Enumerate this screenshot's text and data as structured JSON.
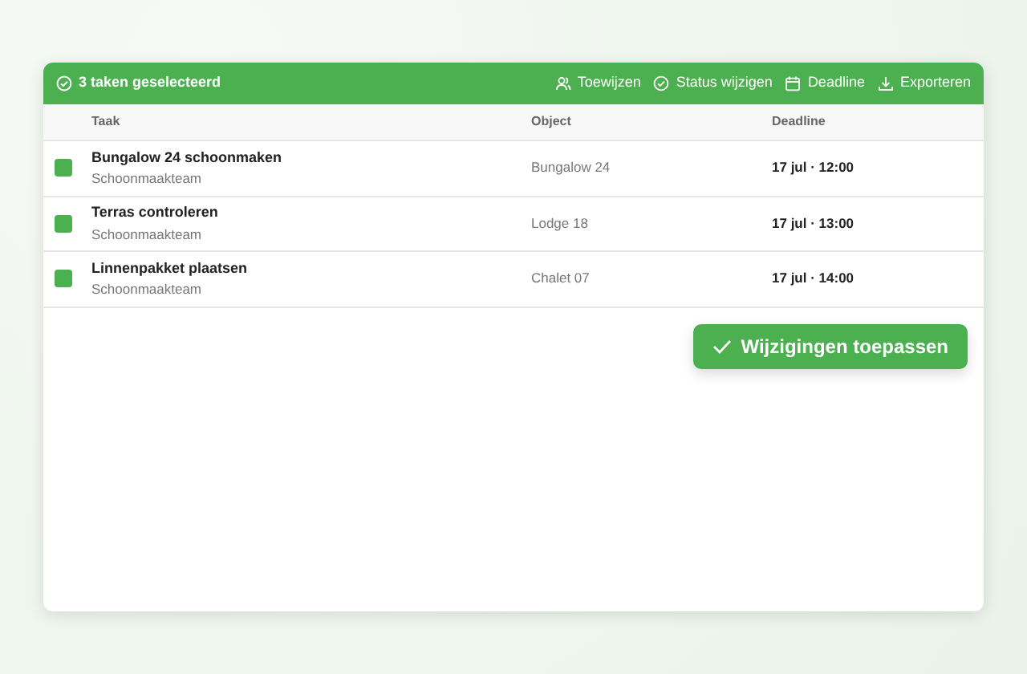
{
  "toolbar": {
    "selection_label": "3 taken geselecteerd",
    "actions": [
      {
        "kind": "assign",
        "label": "Toewijzen"
      },
      {
        "kind": "status",
        "label": "Status wijzigen"
      },
      {
        "kind": "deadline",
        "label": "Deadline"
      },
      {
        "kind": "export",
        "label": "Exporteren"
      }
    ]
  },
  "table": {
    "columns": [
      "Taak",
      "Object",
      "Deadline"
    ],
    "rows": [
      {
        "checked": true,
        "task": "Bungalow 24 schoonmaken",
        "team": "Schoonmaakteam",
        "object": "Bungalow 24",
        "deadline": "17 jul · 12:00"
      },
      {
        "checked": true,
        "task": "Terras controleren",
        "team": "Schoonmaakteam",
        "object": "Lodge 18",
        "deadline": "17 jul · 13:00"
      },
      {
        "checked": true,
        "task": "Linnenpakket plaatsen",
        "team": "Schoonmaakteam",
        "object": "Chalet 07",
        "deadline": "17 jul · 14:00"
      }
    ]
  },
  "apply_button": {
    "label": "Wijzigingen toepassen"
  }
}
